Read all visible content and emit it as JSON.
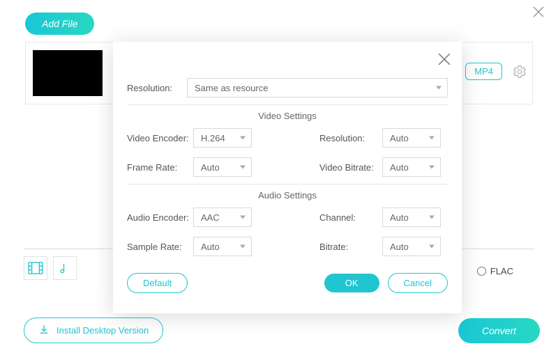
{
  "topbar": {
    "add_file": "Add File"
  },
  "row": {
    "format": "MP4"
  },
  "formats": {
    "radio": "FLAC"
  },
  "footer": {
    "install": "Install Desktop Version",
    "convert": "Convert"
  },
  "modal": {
    "resolution_label": "Resolution:",
    "resolution_value": "Same as resource",
    "video_settings_title": "Video Settings",
    "audio_settings_title": "Audio Settings",
    "video": {
      "encoder_label": "Video Encoder:",
      "encoder_value": "H.264",
      "resolution_label": "Resolution:",
      "resolution_value": "Auto",
      "framerate_label": "Frame Rate:",
      "framerate_value": "Auto",
      "bitrate_label": "Video Bitrate:",
      "bitrate_value": "Auto"
    },
    "audio": {
      "encoder_label": "Audio Encoder:",
      "encoder_value": "AAC",
      "channel_label": "Channel:",
      "channel_value": "Auto",
      "samplerate_label": "Sample Rate:",
      "samplerate_value": "Auto",
      "bitrate_label": "Bitrate:",
      "bitrate_value": "Auto"
    },
    "buttons": {
      "default": "Default",
      "ok": "OK",
      "cancel": "Cancel"
    }
  }
}
